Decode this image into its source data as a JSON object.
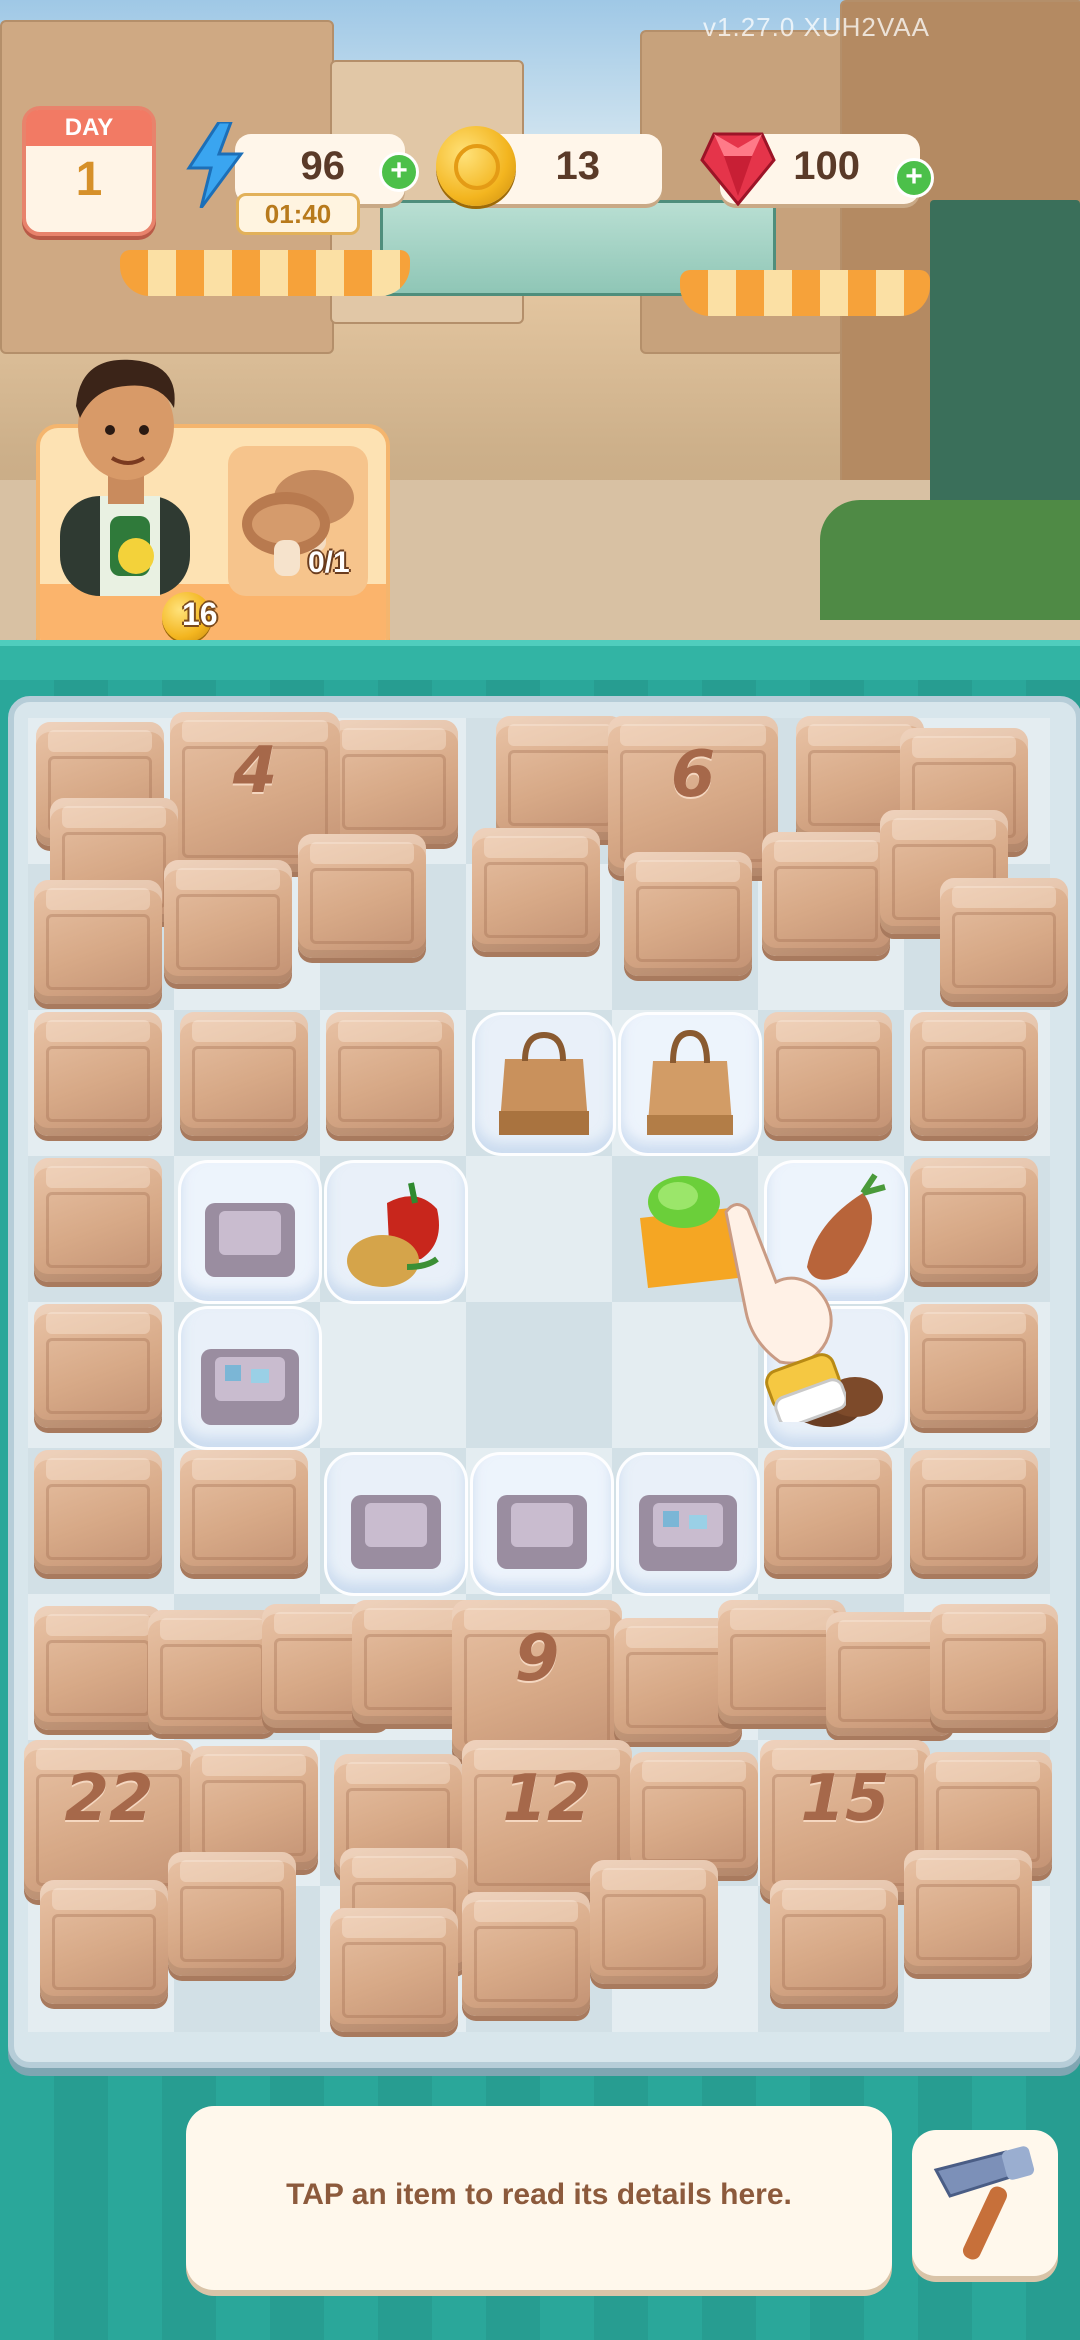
{
  "version": "v1.27.0 XUH2VAA",
  "hud": {
    "day_label": "DAY",
    "day_number": "1",
    "energy": "96",
    "energy_timer": "01:40",
    "coins": "13",
    "gems": "100",
    "plus_symbol": "+"
  },
  "order": {
    "progress": "0/1",
    "reward": "16",
    "item_icon": "mushroom-icon"
  },
  "board": {
    "crate_labels": {
      "c4": "4",
      "c6": "6",
      "c9": "9",
      "c22": "22",
      "c12": "12",
      "c15": "15"
    },
    "items": [
      "paper-bag-icon",
      "paper-bag-icon",
      "box-icon",
      "pepper-onion-icon",
      "grocery-bag-icon",
      "carrot-icon",
      "box-items-icon",
      "potato-icon",
      "box-icon",
      "box-icon",
      "box-items-icon"
    ]
  },
  "info": {
    "text": "TAP an item to read its details here."
  },
  "colors": {
    "teal": "#2aa79a",
    "board": "#d8e6ec",
    "crate": "#d7a987",
    "plus": "#4cc04a"
  }
}
